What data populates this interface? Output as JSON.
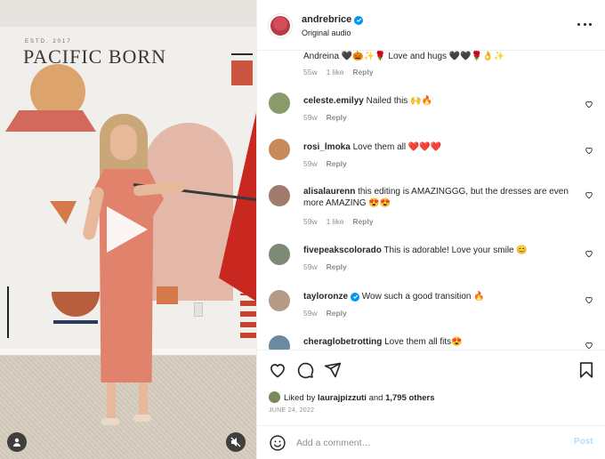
{
  "media": {
    "est_text": "ESTD. 2017",
    "brand_text": "PACIFIC BORN"
  },
  "post": {
    "username": "andrebrice",
    "subtitle": "Original audio"
  },
  "comments": {
    "first_text": "Andreina 🖤🎃✨🌹 Love and hugs 🖤🖤🌹👌✨",
    "first_time": "55w",
    "first_likes": "1 like",
    "first_reply": "Reply",
    "items": [
      {
        "user": "celeste.emilyy",
        "text": "Nailed this 🙌🔥",
        "time": "59w",
        "likes": "",
        "reply": "Reply"
      },
      {
        "user": "rosi_lmoka",
        "text": "Love them all ❤️❤️❤️",
        "time": "59w",
        "likes": "",
        "reply": "Reply"
      },
      {
        "user": "alisalaurenn",
        "text": "this editing is AMAZINGGG, but the dresses are even more AMAZING 😍😍",
        "time": "59w",
        "likes": "1 like",
        "reply": "Reply"
      },
      {
        "user": "fivepeakscolorado",
        "text": "This is adorable! Love your smile 😊",
        "time": "59w",
        "likes": "",
        "reply": "Reply"
      },
      {
        "user": "tayloronze",
        "text": "Wow such a good transition 🔥",
        "time": "59w",
        "likes": "",
        "reply": "Reply"
      },
      {
        "user": "cheraglobetrotting",
        "text": "Love them all fits😍",
        "time": "",
        "likes": "",
        "reply": ""
      }
    ]
  },
  "likes": {
    "prefix": "Liked by",
    "user": "laurajpizzuti",
    "and": "and",
    "others": "1,795 others"
  },
  "date": "JUNE 24, 2022",
  "compose": {
    "placeholder": "Add a comment…",
    "post_label": "Post"
  },
  "colors": {
    "verified": "#0095f6",
    "post_disabled": "#b3dbff",
    "meta": "#8e8e8e"
  }
}
